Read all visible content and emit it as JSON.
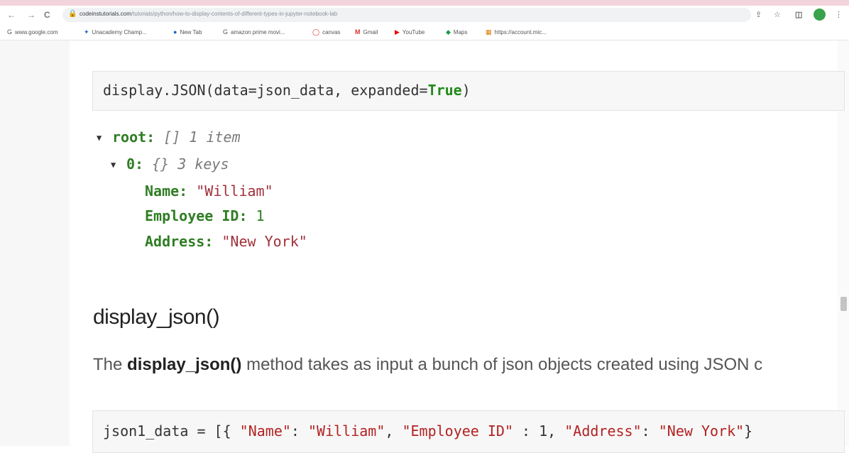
{
  "browser": {
    "url_domain": "codeinstutorials.com",
    "url_path": "/tutorials/python/how-to-display-contents-of-different-types-in-jupyter-notebook-lab",
    "nav_back": "←",
    "nav_forward": "→",
    "nav_reload": "C",
    "bookmarks": [
      {
        "icon": "G",
        "label": "www.google.com"
      },
      {
        "icon": "✦",
        "label": "Unacademy Champ..."
      },
      {
        "icon": "●",
        "label": "New Tab"
      },
      {
        "icon": "G",
        "label": "amazon prime movi..."
      },
      {
        "icon": "◯",
        "label": "canvas"
      },
      {
        "icon": "M",
        "label": "Gmail"
      },
      {
        "icon": "▶",
        "label": "YouTube"
      },
      {
        "icon": "◆",
        "label": "Maps"
      },
      {
        "icon": "▦",
        "label": "https://account.mic..."
      }
    ]
  },
  "cell1": {
    "prefix": "display.JSON(data=json_data, expanded=",
    "keyword": "True",
    "suffix": ")"
  },
  "json_tree": {
    "root_key": "root:",
    "root_meta": "[] 1 item",
    "item_key": "0:",
    "item_meta": "{} 3 keys",
    "fields": [
      {
        "key": "Name:",
        "value": "\"William\""
      },
      {
        "key": "Employee ID:",
        "value": "1"
      },
      {
        "key": "Address:",
        "value": "\"New York\""
      }
    ]
  },
  "section": {
    "heading": "display_json()",
    "para_prefix": "The ",
    "para_bold": "display_json()",
    "para_rest": " method takes as input a bunch of json objects created using JSON c"
  },
  "cell2": {
    "t1": "json1_data = [{ ",
    "s1": "\"Name\"",
    "t2": ": ",
    "s2": "\"William\"",
    "t3": ", ",
    "s3": "\"Employee ID\"",
    "t4": " : 1, ",
    "s4": "\"Address\"",
    "t5": ": ",
    "s5": "\"New York\"",
    "t6": "}"
  }
}
